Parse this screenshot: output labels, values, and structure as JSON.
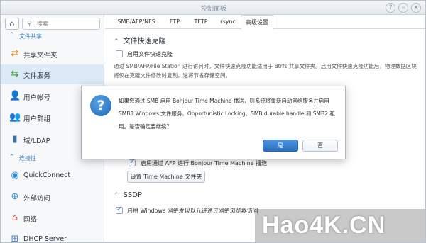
{
  "window": {
    "title": "控制面板",
    "controls": [
      "?",
      "–",
      "×"
    ]
  },
  "sidebar": {
    "home_icon": "home-icon",
    "search_placeholder": "搜索",
    "sections": [
      {
        "label": "文件共享"
      },
      {
        "label": "连接性"
      }
    ],
    "items": [
      {
        "label": "共享文件夹",
        "icon": "shared-folder-icon"
      },
      {
        "label": "文件服务",
        "icon": "file-services-icon",
        "active": true
      },
      {
        "label": "用户帐号",
        "icon": "user-icon"
      },
      {
        "label": "用户群组",
        "icon": "group-icon"
      },
      {
        "label": "域/LDAP",
        "icon": "domain-icon"
      },
      {
        "label": "QuickConnect",
        "icon": "quickconnect-icon"
      },
      {
        "label": "外部访问",
        "icon": "external-access-icon"
      },
      {
        "label": "网络",
        "icon": "network-icon"
      },
      {
        "label": "DHCP Server",
        "icon": "dhcp-icon"
      }
    ]
  },
  "tabs": [
    {
      "label": "SMB/AFP/NFS"
    },
    {
      "label": "FTP"
    },
    {
      "label": "TFTP"
    },
    {
      "label": "rsync"
    },
    {
      "label": "高级设置",
      "active": true
    }
  ],
  "content": {
    "fast_clone": {
      "heading": "文件快速克隆",
      "checkbox_label": "启用文件快速克隆",
      "description": "通过 SMB/AFP/File Station 进行访问时，文件快速克隆功能适用于 Btrfs 共享文件夹。启用文件快速克隆功能后，物理数据区块将仅在克隆文件修改时复制，这将节省存储空间。"
    },
    "bonjour": {
      "checkbox_label": "启用通过 AFP 进行 Bonjour Time Machine 播送",
      "button_label": "设置 Time Machine 文件夹"
    },
    "ssdp": {
      "heading": "SSDP",
      "checkbox_label": "启用 Windows 网络发现以允许通过网络浏览器访问"
    }
  },
  "dialog": {
    "icon": "question-icon",
    "message": "如果您通过 SMB 启用 Bonjour Time Machine 播送，则系统将重新启动网络服务并启用 SMB3 Windows 文件服务、Opportunistic Locking、SMB durable handle 和 SMB2 租用。是否确定要继续？",
    "yes_label": "是",
    "no_label": "否"
  },
  "watermark": {
    "text": "Hao4K.CN"
  }
}
